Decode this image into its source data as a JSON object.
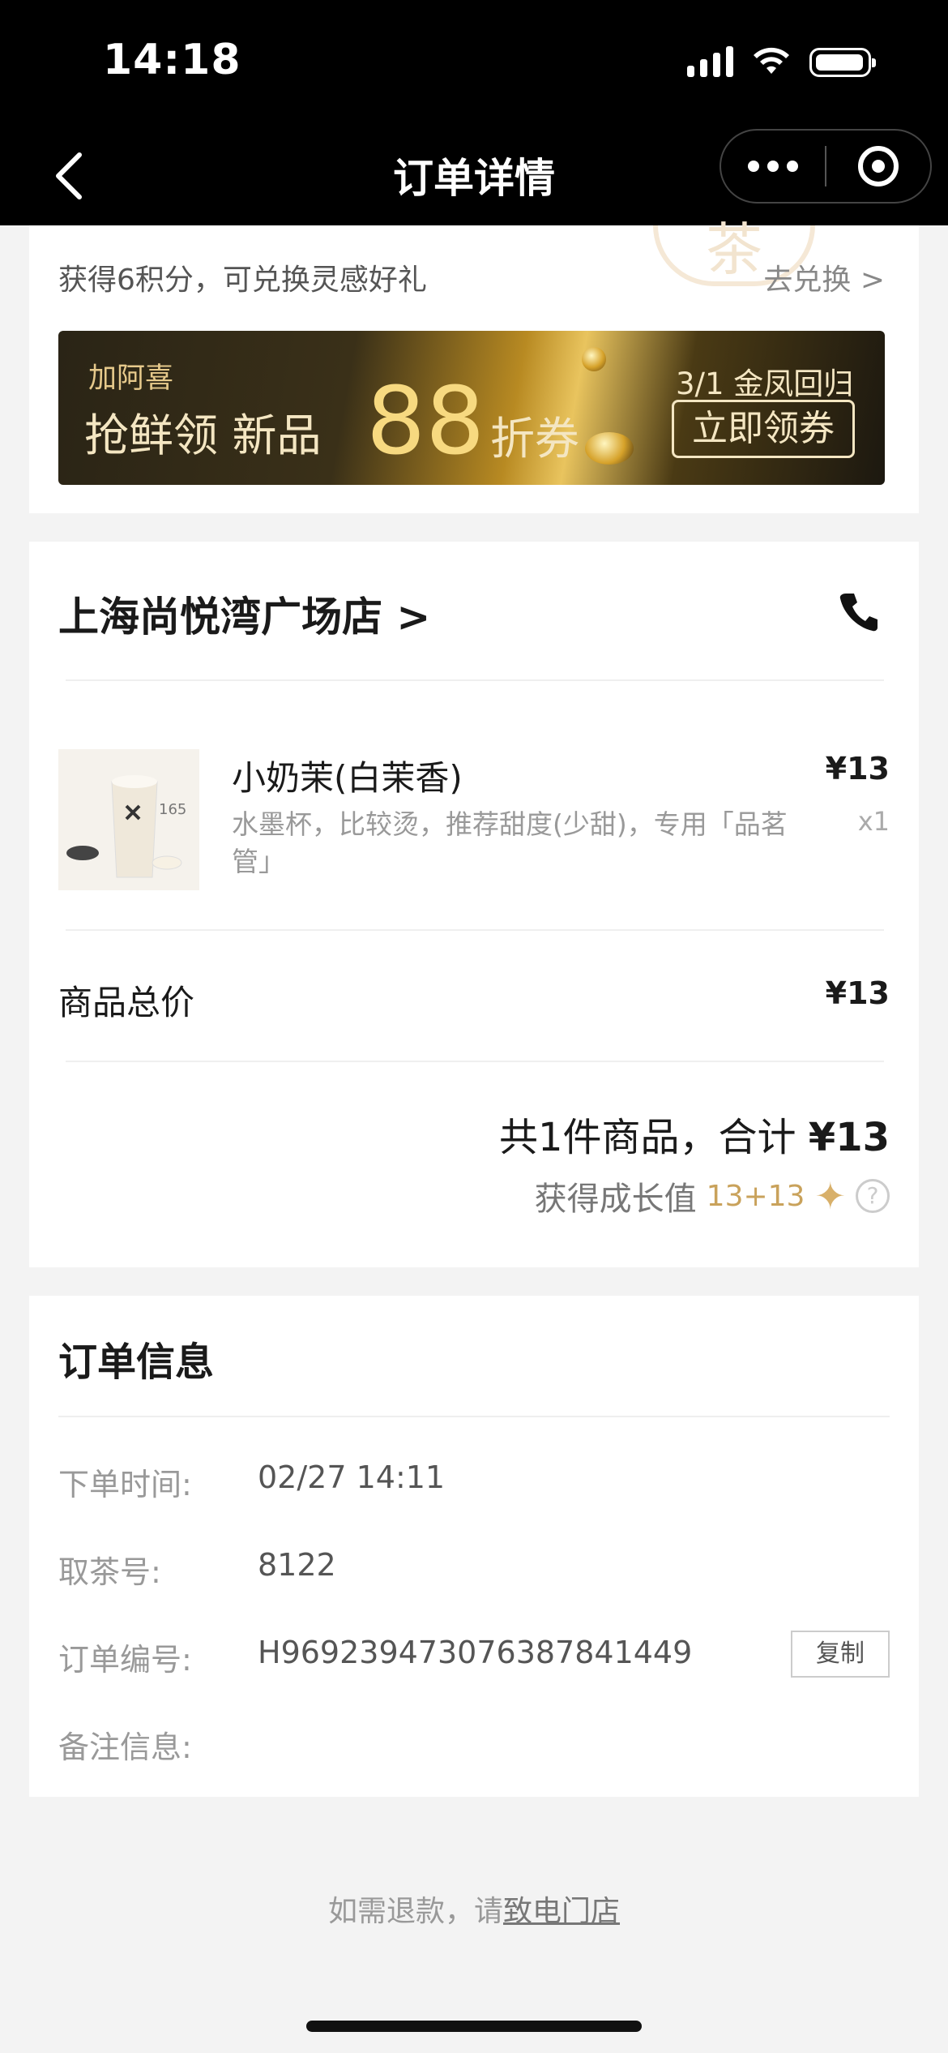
{
  "status_bar": {
    "time": "14:18"
  },
  "nav": {
    "title": "订单详情"
  },
  "points": {
    "text": "获得6积分，可兑换灵感好礼",
    "link": "去兑换 >",
    "watermark": "茶"
  },
  "banner": {
    "brand": "加阿喜",
    "main_text": "抢鲜领 新品",
    "number": "88",
    "tail": "折券",
    "date": "3/1 金凤回归",
    "button": "立即领券"
  },
  "store": {
    "name": "上海尚悦湾广场店 >"
  },
  "product": {
    "name": "小奶茉(白茉香)",
    "spec": "水墨杯，比较烫，推荐甜度(少甜)，专用「品茗管」",
    "price": "¥13",
    "qty": "x1",
    "image_label": "165"
  },
  "summary": {
    "subtotal_label": "商品总价",
    "subtotal_value": "¥13",
    "total_prefix": "共1件商品，合计 ",
    "total_value": "¥13",
    "growth_label": "获得成长值",
    "growth_value": "13+13",
    "star": "✦",
    "help": "?"
  },
  "order_info": {
    "title": "订单信息",
    "time_label": "下单时间:",
    "time_value": "02/27 14:11",
    "pickup_label": "取茶号:",
    "pickup_value": "8122",
    "number_label": "订单编号:",
    "number_value": "H969239473076387841449",
    "copy_button": "复制",
    "note_label": "备注信息:"
  },
  "footer": {
    "prefix": "如需退款，请",
    "link": "致电门店"
  },
  "colors": {
    "gold": "#c9a25b",
    "header_bg": "#000000"
  }
}
